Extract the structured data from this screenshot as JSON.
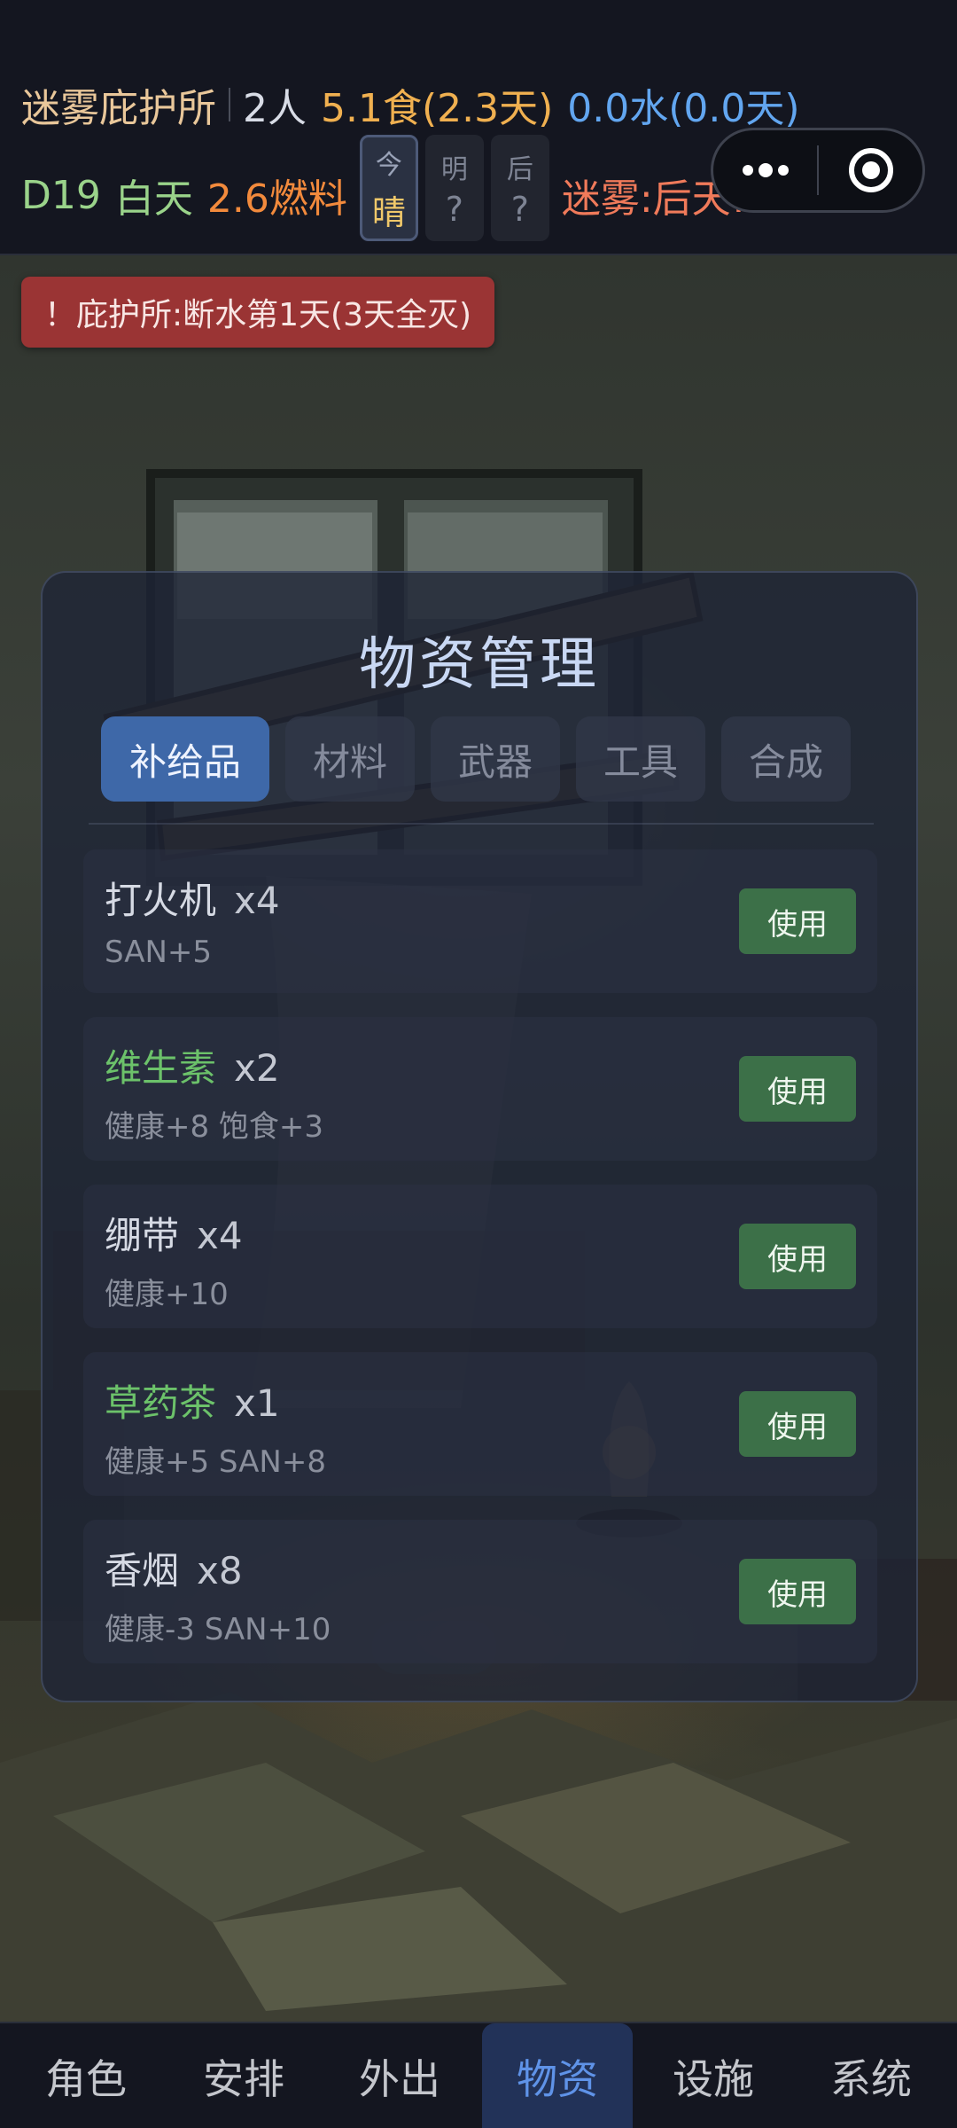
{
  "status": {
    "shelter_name": "迷雾庇护所",
    "people": "2人",
    "food": "5.1食(2.3天)",
    "water": "0.0水(0.0天)",
    "day": "D19",
    "time_of_day": "白天",
    "fuel": "2.6燃料",
    "forecast": [
      {
        "day": "今",
        "weather": "晴"
      },
      {
        "day": "明",
        "weather": "?"
      },
      {
        "day": "后",
        "weather": "?"
      }
    ],
    "fog_warning": "迷雾:后天!"
  },
  "colors": {
    "shelter": "#e9c79a",
    "people": "#d8dce6",
    "food": "#f0b050",
    "water": "#62a6f0",
    "day": "#9ad38a",
    "fuel": "#f28a3c",
    "fog": "#f07a5a",
    "alert_bg": "#9a3434",
    "accent": "#3e68a8",
    "use_button": "#3c7048",
    "green_name": "#6cc26a"
  },
  "alert": {
    "text": "！庇护所:断水第1天(3天全灭)"
  },
  "panel": {
    "title": "物资管理",
    "tabs": [
      {
        "label": "补给品",
        "active": true
      },
      {
        "label": "材料",
        "active": false
      },
      {
        "label": "武器",
        "active": false
      },
      {
        "label": "工具",
        "active": false
      },
      {
        "label": "合成",
        "active": false
      }
    ],
    "items": [
      {
        "name": "打火机",
        "count": "x4",
        "effect": "SAN+5",
        "highlight": false,
        "button": "使用"
      },
      {
        "name": "维生素",
        "count": "x2",
        "effect": "健康+8 饱食+3",
        "highlight": true,
        "button": "使用"
      },
      {
        "name": "绷带",
        "count": "x4",
        "effect": "健康+10",
        "highlight": false,
        "button": "使用"
      },
      {
        "name": "草药茶",
        "count": "x1",
        "effect": "健康+5 SAN+8",
        "highlight": true,
        "button": "使用"
      },
      {
        "name": "香烟",
        "count": "x8",
        "effect": "健康-3 SAN+10",
        "highlight": false,
        "button": "使用"
      }
    ]
  },
  "nav": {
    "items": [
      {
        "label": "角色",
        "active": false
      },
      {
        "label": "安排",
        "active": false
      },
      {
        "label": "外出",
        "active": false
      },
      {
        "label": "物资",
        "active": true
      },
      {
        "label": "设施",
        "active": false
      },
      {
        "label": "系统",
        "active": false
      }
    ]
  },
  "capsule": {
    "more_icon": "more-dots-icon",
    "close_icon": "target-circle-icon"
  }
}
